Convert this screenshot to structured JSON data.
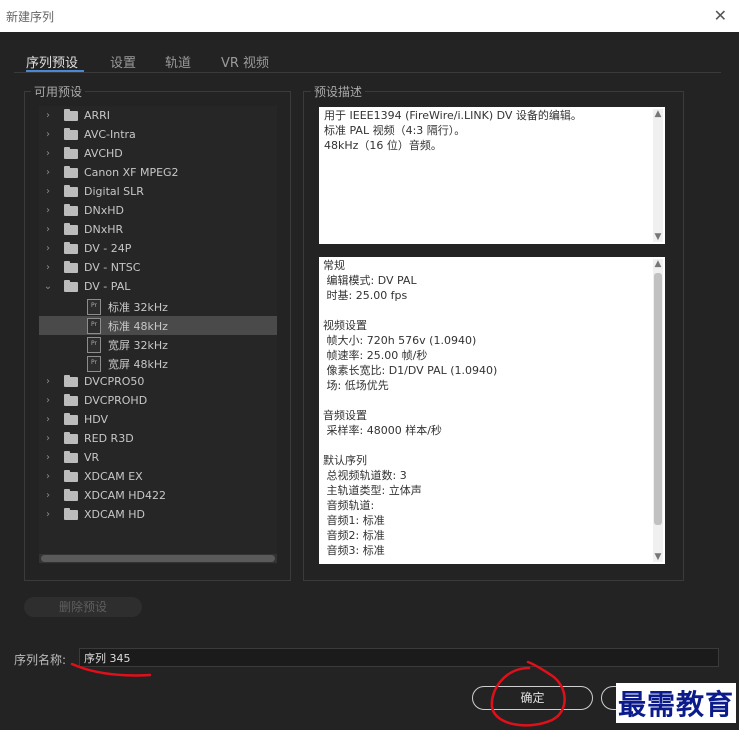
{
  "window": {
    "title": "新建序列",
    "close_glyph": "✕"
  },
  "tabs": [
    {
      "label": "序列预设",
      "active": true
    },
    {
      "label": "设置",
      "active": false
    },
    {
      "label": "轨道",
      "active": false
    },
    {
      "label": "VR 视频",
      "active": false
    }
  ],
  "presets": {
    "heading": "可用预设",
    "items": [
      {
        "label": "ARRI",
        "type": "folder",
        "expanded": false
      },
      {
        "label": "AVC-Intra",
        "type": "folder",
        "expanded": false
      },
      {
        "label": "AVCHD",
        "type": "folder",
        "expanded": false
      },
      {
        "label": "Canon XF MPEG2",
        "type": "folder",
        "expanded": false
      },
      {
        "label": "Digital SLR",
        "type": "folder",
        "expanded": false
      },
      {
        "label": "DNxHD",
        "type": "folder",
        "expanded": false
      },
      {
        "label": "DNxHR",
        "type": "folder",
        "expanded": false
      },
      {
        "label": "DV - 24P",
        "type": "folder",
        "expanded": false
      },
      {
        "label": "DV - NTSC",
        "type": "folder",
        "expanded": false
      },
      {
        "label": "DV - PAL",
        "type": "folder",
        "expanded": true
      },
      {
        "label": "标准 32kHz",
        "type": "preset",
        "selected": false
      },
      {
        "label": "标准 48kHz",
        "type": "preset",
        "selected": true
      },
      {
        "label": "宽屏 32kHz",
        "type": "preset",
        "selected": false
      },
      {
        "label": "宽屏 48kHz",
        "type": "preset",
        "selected": false
      },
      {
        "label": "DVCPRO50",
        "type": "folder",
        "expanded": false
      },
      {
        "label": "DVCPROHD",
        "type": "folder",
        "expanded": false
      },
      {
        "label": "HDV",
        "type": "folder",
        "expanded": false
      },
      {
        "label": "RED R3D",
        "type": "folder",
        "expanded": false
      },
      {
        "label": "VR",
        "type": "folder",
        "expanded": false
      },
      {
        "label": "XDCAM EX",
        "type": "folder",
        "expanded": false
      },
      {
        "label": "XDCAM HD422",
        "type": "folder",
        "expanded": false
      },
      {
        "label": "XDCAM HD",
        "type": "folder",
        "expanded": false
      }
    ],
    "delete_label": "删除预设"
  },
  "description": {
    "heading": "预设描述",
    "lines": [
      "用于 IEEE1394 (FireWire/i.LINK) DV 设备的编辑。",
      "标准 PAL 视频（4:3 隔行）。",
      "48kHz（16 位）音频。"
    ]
  },
  "details": {
    "lines": [
      "常规",
      " 编辑模式: DV PAL",
      " 时基: 25.00 fps",
      "",
      "视频设置",
      " 帧大小: 720h 576v (1.0940)",
      " 帧速率: 25.00 帧/秒",
      " 像素长宽比: D1/DV PAL (1.0940)",
      " 场: 低场优先",
      "",
      "音频设置",
      " 采样率: 48000 样本/秒",
      "",
      "默认序列",
      " 总视频轨道数: 3",
      " 主轨道类型: 立体声",
      " 音频轨道:",
      " 音频1: 标准",
      " 音频2: 标准",
      " 音频3: 标准"
    ]
  },
  "sequence_name": {
    "label": "序列名称:",
    "value": "序列 345"
  },
  "buttons": {
    "ok": "确定"
  },
  "watermark": "最需教育",
  "icons": {
    "chevron_right": "›",
    "chevron_down": "⌄",
    "scroll_up": "▲",
    "scroll_down": "▼",
    "preset_file": "Pr"
  },
  "colors": {
    "accent": "#4a88d4",
    "selection": "#4a4a4a",
    "annotation": "#e0101a"
  }
}
